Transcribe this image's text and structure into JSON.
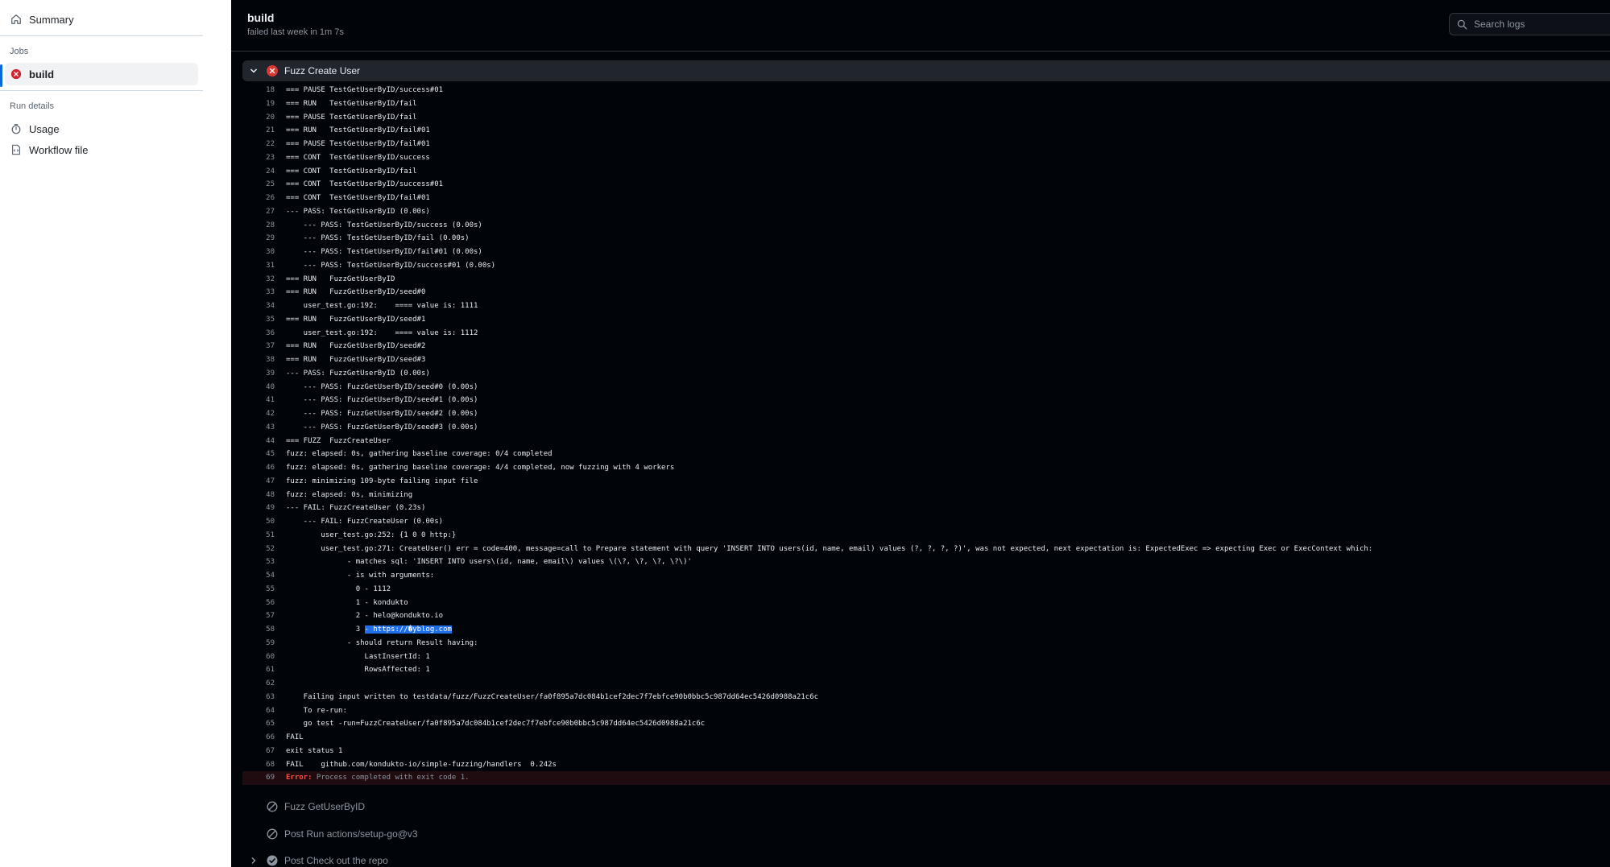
{
  "sidebar": {
    "summary_label": "Summary",
    "jobs_heading": "Jobs",
    "job_build_label": "build",
    "run_details_heading": "Run details",
    "usage_label": "Usage",
    "workflow_file_label": "Workflow file"
  },
  "header": {
    "title": "build",
    "subtitle": "failed last week in 1m 7s",
    "search_placeholder": "Search logs"
  },
  "step": {
    "title": "Fuzz Create User",
    "status": "failed"
  },
  "log_lines": [
    {
      "n": "18",
      "t": "=== PAUSE TestGetUserByID/success#01"
    },
    {
      "n": "19",
      "t": "=== RUN   TestGetUserByID/fail"
    },
    {
      "n": "20",
      "t": "=== PAUSE TestGetUserByID/fail"
    },
    {
      "n": "21",
      "t": "=== RUN   TestGetUserByID/fail#01"
    },
    {
      "n": "22",
      "t": "=== PAUSE TestGetUserByID/fail#01"
    },
    {
      "n": "23",
      "t": "=== CONT  TestGetUserByID/success"
    },
    {
      "n": "24",
      "t": "=== CONT  TestGetUserByID/fail"
    },
    {
      "n": "25",
      "t": "=== CONT  TestGetUserByID/success#01"
    },
    {
      "n": "26",
      "t": "=== CONT  TestGetUserByID/fail#01"
    },
    {
      "n": "27",
      "t": "--- PASS: TestGetUserByID (0.00s)"
    },
    {
      "n": "28",
      "t": "    --- PASS: TestGetUserByID/success (0.00s)"
    },
    {
      "n": "29",
      "t": "    --- PASS: TestGetUserByID/fail (0.00s)"
    },
    {
      "n": "30",
      "t": "    --- PASS: TestGetUserByID/fail#01 (0.00s)"
    },
    {
      "n": "31",
      "t": "    --- PASS: TestGetUserByID/success#01 (0.00s)"
    },
    {
      "n": "32",
      "t": "=== RUN   FuzzGetUserByID"
    },
    {
      "n": "33",
      "t": "=== RUN   FuzzGetUserByID/seed#0"
    },
    {
      "n": "34",
      "t": "    user_test.go:192:    ==== value is: 1111"
    },
    {
      "n": "35",
      "t": "=== RUN   FuzzGetUserByID/seed#1"
    },
    {
      "n": "36",
      "t": "    user_test.go:192:    ==== value is: 1112"
    },
    {
      "n": "37",
      "t": "=== RUN   FuzzGetUserByID/seed#2"
    },
    {
      "n": "38",
      "t": "=== RUN   FuzzGetUserByID/seed#3"
    },
    {
      "n": "39",
      "t": "--- PASS: FuzzGetUserByID (0.00s)"
    },
    {
      "n": "40",
      "t": "    --- PASS: FuzzGetUserByID/seed#0 (0.00s)"
    },
    {
      "n": "41",
      "t": "    --- PASS: FuzzGetUserByID/seed#1 (0.00s)"
    },
    {
      "n": "42",
      "t": "    --- PASS: FuzzGetUserByID/seed#2 (0.00s)"
    },
    {
      "n": "43",
      "t": "    --- PASS: FuzzGetUserByID/seed#3 (0.00s)"
    },
    {
      "n": "44",
      "t": "=== FUZZ  FuzzCreateUser"
    },
    {
      "n": "45",
      "t": "fuzz: elapsed: 0s, gathering baseline coverage: 0/4 completed"
    },
    {
      "n": "46",
      "t": "fuzz: elapsed: 0s, gathering baseline coverage: 4/4 completed, now fuzzing with 4 workers"
    },
    {
      "n": "47",
      "t": "fuzz: minimizing 109-byte failing input file"
    },
    {
      "n": "48",
      "t": "fuzz: elapsed: 0s, minimizing"
    },
    {
      "n": "49",
      "t": "--- FAIL: FuzzCreateUser (0.23s)"
    },
    {
      "n": "50",
      "t": "    --- FAIL: FuzzCreateUser (0.00s)"
    },
    {
      "n": "51",
      "t": "        user_test.go:252: {1 0 0 http:}"
    },
    {
      "n": "52",
      "t": "        user_test.go:271: CreateUser() err = code=400, message=call to Prepare statement with query 'INSERT INTO users(id, name, email) values (?, ?, ?, ?)', was not expected, next expectation is: ExpectedExec => expecting Exec or ExecContext which:"
    },
    {
      "n": "53",
      "t": "              - matches sql: 'INSERT INTO users\\(id, name, email\\) values \\(\\?, \\?, \\?, \\?\\)'"
    },
    {
      "n": "54",
      "t": "              - is with arguments:"
    },
    {
      "n": "55",
      "t": "                0 - 1112"
    },
    {
      "n": "56",
      "t": "                1 - kondukto"
    },
    {
      "n": "57",
      "t": "                2 - helo@kondukto.io"
    },
    {
      "n": "58",
      "t": "                3 ",
      "hl": "- https://�yblog.com"
    },
    {
      "n": "59",
      "t": "              - should return Result having:"
    },
    {
      "n": "60",
      "t": "                  LastInsertId: 1"
    },
    {
      "n": "61",
      "t": "                  RowsAffected: 1"
    },
    {
      "n": "62",
      "t": ""
    },
    {
      "n": "63",
      "t": "    Failing input written to testdata/fuzz/FuzzCreateUser/fa0f895a7dc084b1cef2dec7f7ebfce90b0bbc5c987dd64ec5426d0988a21c6c"
    },
    {
      "n": "64",
      "t": "    To re-run:"
    },
    {
      "n": "65",
      "t": "    go test -run=FuzzCreateUser/fa0f895a7dc084b1cef2dec7f7ebfce90b0bbc5c987dd64ec5426d0988a21c6c"
    },
    {
      "n": "66",
      "t": "FAIL"
    },
    {
      "n": "67",
      "t": "exit status 1"
    },
    {
      "n": "68",
      "t": "FAIL    github.com/kondukto-io/simple-fuzzing/handlers  0.242s"
    }
  ],
  "error_line": {
    "n": "69",
    "label": "Error:",
    "message": " Process completed with exit code 1."
  },
  "steps": [
    {
      "label": "Fuzz GetUserByID",
      "status": "skipped",
      "icon": "skipped-icon"
    },
    {
      "label": "Post Run actions/setup-go@v3",
      "status": "skipped",
      "icon": "skipped-icon"
    },
    {
      "label": "Post Check out the repo",
      "status": "success",
      "icon": "check-circle-icon"
    }
  ]
}
